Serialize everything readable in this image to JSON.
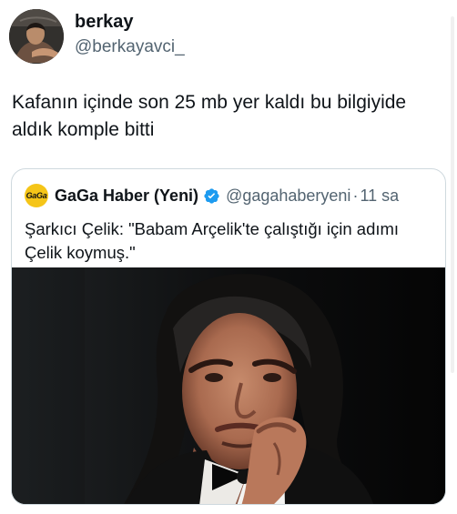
{
  "tweet": {
    "author": {
      "display_name": "berkay",
      "handle": "@berkayavci_",
      "avatar_icon": "profile-photo"
    },
    "text": "Kafanın içinde son 25 mb yer kaldı bu bilgiyide aldık komple bitti"
  },
  "quoted_tweet": {
    "author": {
      "avatar_label": "GaGa",
      "display_name": "GaGa Haber (Yeni)",
      "handle": "@gagahaberyeni",
      "separator": "·",
      "time": "11 sa",
      "verified_icon": "verified-badge-icon",
      "verified_color": "#1d9bf0"
    },
    "text": "Şarkıcı Çelik: \"Babam Arçelik'te çalıştığı için adımı Çelik koymuş.\"",
    "media_icon": "portrait-photo"
  },
  "colors": {
    "text_primary": "#0f1419",
    "text_secondary": "#536471",
    "border": "#cfd9de",
    "gaga_yellow": "#f5c518"
  }
}
